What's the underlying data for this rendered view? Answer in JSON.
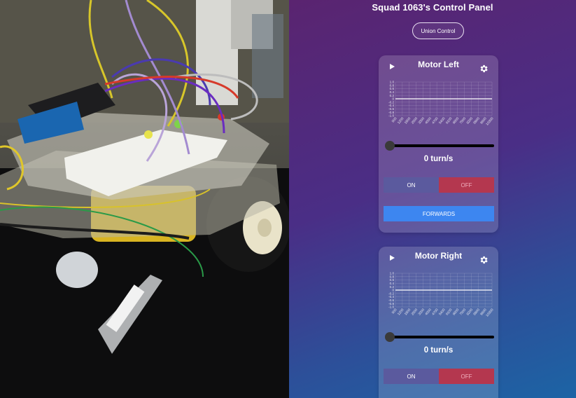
{
  "panel": {
    "title": "Squad 1063's Control Panel",
    "union_button": "Union Control"
  },
  "motors": [
    {
      "title": "Motor Left",
      "speed_label": "0 turn/s",
      "on_label": "ON",
      "off_label": "OFF",
      "direction_label": "FORWARDS",
      "play_icon": "play-icon",
      "settings_icon": "gear-icon",
      "slider_value": 0,
      "chart_data": {
        "type": "line",
        "x_ticks": [
          "500",
          "1200",
          "1900",
          "2600",
          "3300",
          "4000",
          "4700",
          "5400",
          "6100",
          "6800",
          "7500",
          "8200",
          "8900",
          "9600",
          "10300"
        ],
        "y_ticks": [
          "1.0",
          "0.8",
          "0.6",
          "0.4",
          "0.2",
          "0",
          "-0.2",
          "-0.4",
          "-0.6",
          "-0.8",
          "-1.0"
        ],
        "ylim": [
          -1,
          1
        ],
        "series": [
          {
            "values": [
              0,
              0,
              0,
              0,
              0,
              0,
              0,
              0,
              0,
              0,
              0,
              0,
              0,
              0,
              0
            ]
          }
        ],
        "grid": true
      }
    },
    {
      "title": "Motor Right",
      "speed_label": "0 turn/s",
      "on_label": "ON",
      "off_label": "OFF",
      "play_icon": "play-icon",
      "settings_icon": "gear-icon",
      "slider_value": 0,
      "chart_data": {
        "type": "line",
        "x_ticks": [
          "500",
          "1200",
          "1900",
          "2600",
          "3300",
          "4000",
          "4700",
          "5400",
          "6100",
          "6800",
          "7500",
          "8200",
          "8900",
          "9600",
          "10300"
        ],
        "y_ticks": [
          "1.0",
          "0.8",
          "0.6",
          "0.4",
          "0.2",
          "0",
          "-0.2",
          "-0.4",
          "-0.6",
          "-0.8",
          "-1.0"
        ],
        "ylim": [
          -1,
          1
        ],
        "series": [
          {
            "values": [
              0,
              0,
              0,
              0,
              0,
              0,
              0,
              0,
              0,
              0,
              0,
              0,
              0,
              0,
              0
            ]
          }
        ],
        "grid": true
      }
    }
  ],
  "colors": {
    "on_button": "#5b5a9e",
    "off_button": "#b4374f",
    "direction_button": "#3d86f0"
  }
}
